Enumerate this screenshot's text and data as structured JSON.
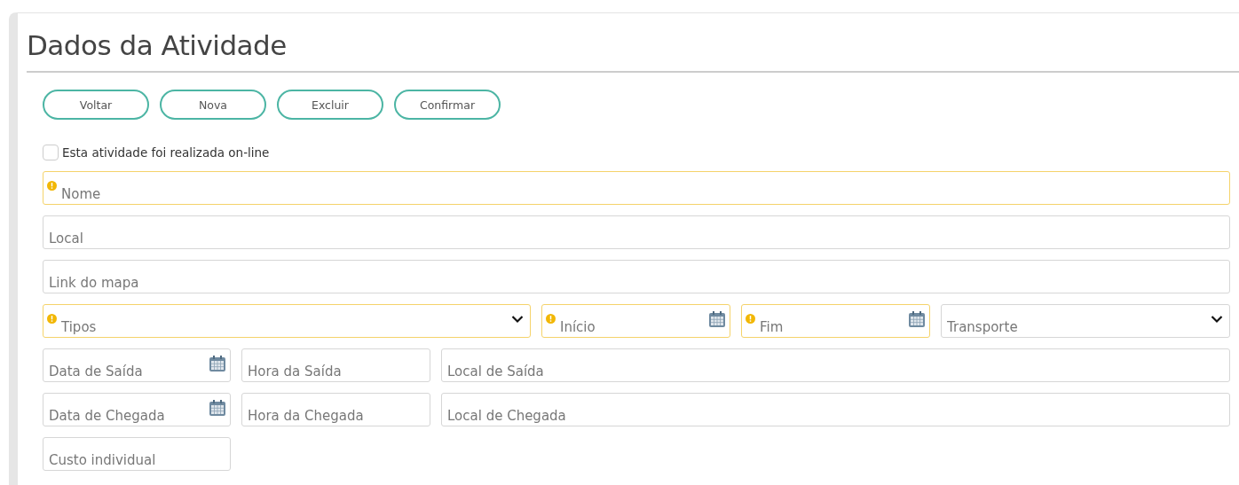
{
  "title": "Dados da Atividade",
  "buttons": [
    "Voltar",
    "Nova",
    "Excluir",
    "Confirmar"
  ],
  "online_checkbox": {
    "label": "Esta atividade foi realizada on-line",
    "checked": false
  },
  "rows": [
    [
      {
        "placeholder": "Nome",
        "required": true,
        "kind": "text"
      }
    ],
    [
      {
        "placeholder": "Local",
        "required": false,
        "kind": "text"
      }
    ],
    [
      {
        "placeholder": "Link do mapa",
        "required": false,
        "kind": "text"
      }
    ],
    [
      {
        "placeholder": "Tipos",
        "required": true,
        "kind": "select"
      },
      {
        "placeholder": "Início",
        "required": true,
        "kind": "date"
      },
      {
        "placeholder": "Fim",
        "required": true,
        "kind": "date"
      },
      {
        "placeholder": "Transporte",
        "required": false,
        "kind": "select"
      }
    ],
    [
      {
        "placeholder": "Data de Saída",
        "required": false,
        "kind": "date"
      },
      {
        "placeholder": "Hora da Saída",
        "required": false,
        "kind": "text"
      },
      {
        "placeholder": "Local de Saída",
        "required": false,
        "kind": "text"
      }
    ],
    [
      {
        "placeholder": "Data de Chegada",
        "required": false,
        "kind": "date"
      },
      {
        "placeholder": "Hora da Chegada",
        "required": false,
        "kind": "text"
      },
      {
        "placeholder": "Local de Chegada",
        "required": false,
        "kind": "text"
      }
    ],
    [
      {
        "placeholder": "Custo individual",
        "required": false,
        "kind": "text"
      }
    ]
  ]
}
